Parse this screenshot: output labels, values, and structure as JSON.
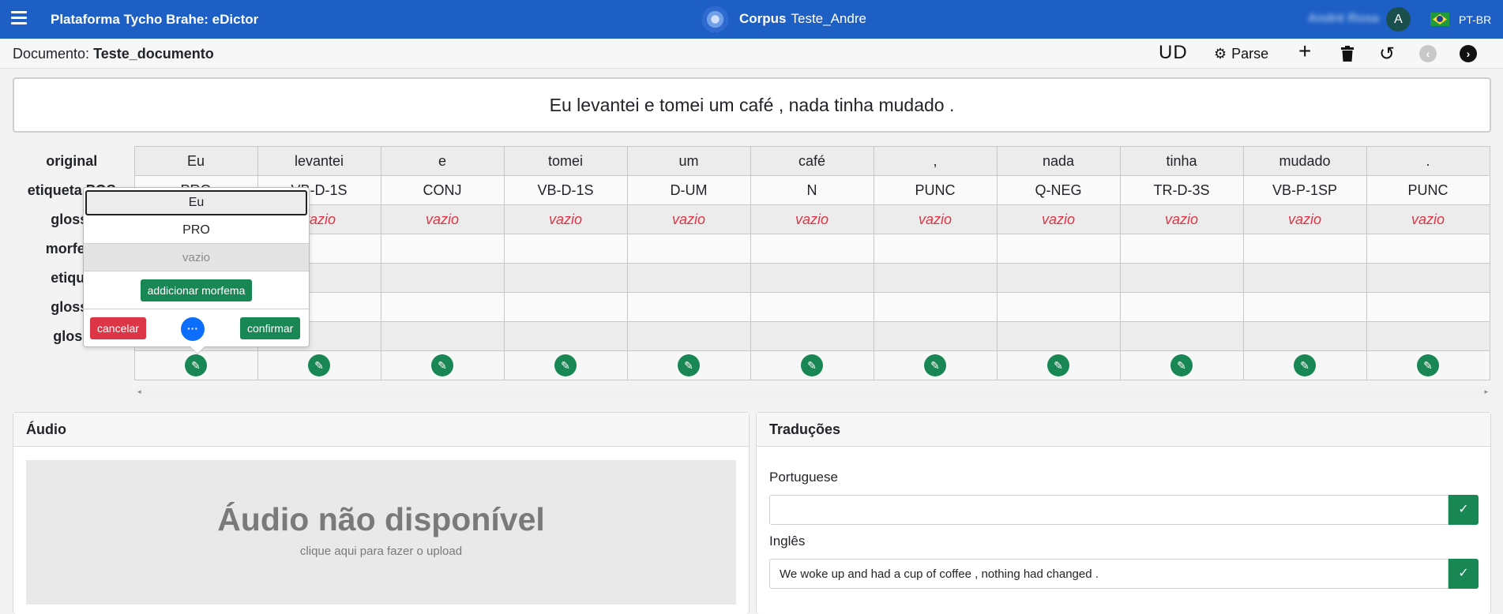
{
  "navbar": {
    "app_title": "Plataforma Tycho Brahe: eDictor",
    "corpus_label": "Corpus",
    "corpus_name": "Teste_Andre",
    "user_name": "André Rosa",
    "avatar_letter": "A",
    "language": "PT-BR",
    "color": "#1d5fc5"
  },
  "docbar": {
    "label": "Documento:",
    "name": "Teste_documento",
    "ud": "UD",
    "parse": "Parse"
  },
  "sentence": "Eu levantei e tomei um café , nada tinha mudado .",
  "table": {
    "row_labels": [
      "original",
      "etiqueta POS",
      "gloss-",
      "morfem",
      "etique",
      "gloss-",
      "gloss"
    ],
    "tokens": [
      {
        "original": "Eu",
        "pos": "PRO",
        "gloss": "vazio"
      },
      {
        "original": "levantei",
        "pos": "VB-D-1S",
        "gloss": "vazio"
      },
      {
        "original": "e",
        "pos": "CONJ",
        "gloss": "vazio"
      },
      {
        "original": "tomei",
        "pos": "VB-D-1S",
        "gloss": "vazio"
      },
      {
        "original": "um",
        "pos": "D-UM",
        "gloss": "vazio"
      },
      {
        "original": "café",
        "pos": "N",
        "gloss": "vazio"
      },
      {
        "original": ",",
        "pos": "PUNC",
        "gloss": "vazio"
      },
      {
        "original": "nada",
        "pos": "Q-NEG",
        "gloss": "vazio"
      },
      {
        "original": "tinha",
        "pos": "TR-D-3S",
        "gloss": "vazio"
      },
      {
        "original": "mudado",
        "pos": "VB-P-1SP",
        "gloss": "vazio"
      },
      {
        "original": ".",
        "pos": "PUNC",
        "gloss": "vazio"
      }
    ]
  },
  "popover": {
    "word": "Eu",
    "pos": "PRO",
    "gloss": "vazio",
    "add_label": "addicionar morfema",
    "cancel_label": "cancelar",
    "more_label": "···",
    "confirm_label": "confirmar"
  },
  "audio": {
    "title": "Áudio",
    "unavailable": "Áudio não disponível",
    "hint": "clique aqui para fazer o upload"
  },
  "translations": {
    "title": "Traduções",
    "items": [
      {
        "label": "Portuguese",
        "value": ""
      },
      {
        "label": "Inglês",
        "value": "We woke up and had a cup of coffee , nothing had changed ."
      }
    ]
  }
}
